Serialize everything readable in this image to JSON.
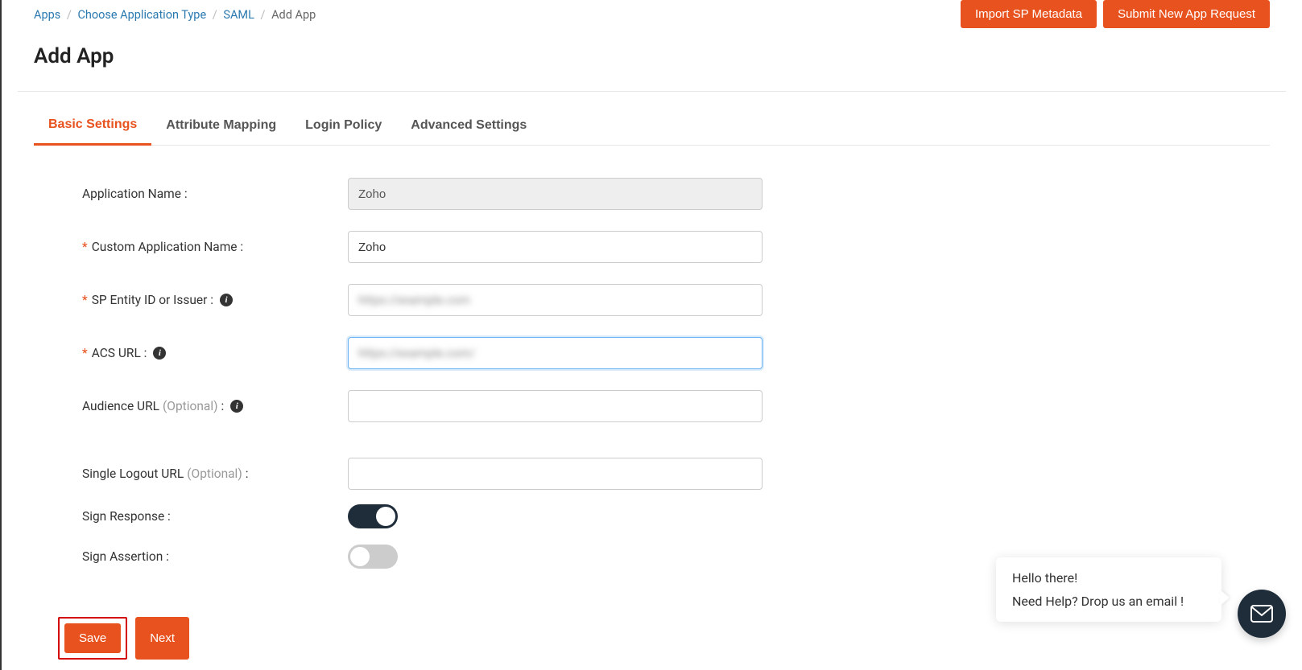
{
  "breadcrumb": {
    "items": [
      "Apps",
      "Choose Application Type",
      "SAML"
    ],
    "current": "Add App"
  },
  "topButtons": {
    "import": "Import SP Metadata",
    "submit": "Submit New App Request"
  },
  "pageTitle": "Add App",
  "tabs": {
    "basic": "Basic Settings",
    "attribute": "Attribute Mapping",
    "login": "Login Policy",
    "advanced": "Advanced Settings"
  },
  "form": {
    "appNameLabel": "Application Name :",
    "appNameValue": "Zoho",
    "customNameLabel": "Custom Application Name :",
    "customNameValue": "Zoho",
    "spEntityLabel": "SP Entity ID or Issuer :",
    "spEntityValue": "https://example.com",
    "acsLabel": "ACS URL :",
    "acsValue": "https://example.com/",
    "audienceLabel": "Audience URL ",
    "audienceOptional": "(Optional)",
    "audienceColon": " :",
    "audienceValue": "",
    "sloLabel": "Single Logout URL ",
    "sloOptional": "(Optional)",
    "sloColon": " :",
    "sloValue": "",
    "signResponseLabel": "Sign Response :",
    "signAssertionLabel": "Sign Assertion :"
  },
  "buttons": {
    "save": "Save",
    "next": "Next"
  },
  "chat": {
    "line1": "Hello there!",
    "line2": "Need Help? Drop us an email !"
  }
}
